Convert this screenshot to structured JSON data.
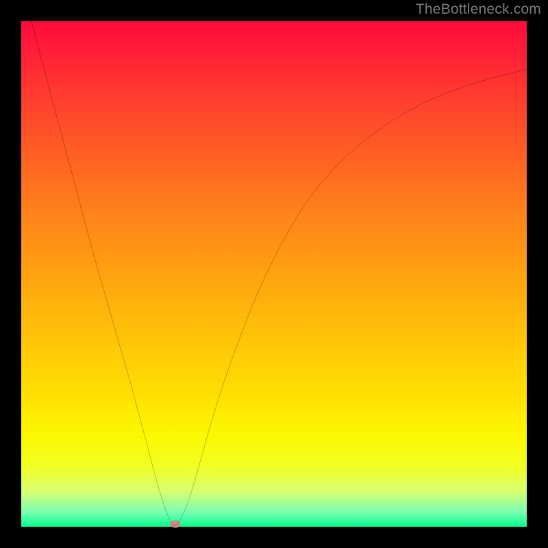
{
  "attribution": "TheBottleneck.com",
  "chart_data": {
    "type": "line",
    "title": "",
    "xlabel": "",
    "ylabel": "",
    "x_range": [
      0,
      100
    ],
    "y_range": [
      0,
      100
    ],
    "x": [
      2,
      6,
      10,
      14,
      18,
      22,
      26,
      28,
      29.5,
      30.5,
      32,
      34,
      38,
      42,
      48,
      55,
      62,
      70,
      78,
      86,
      94,
      100
    ],
    "values": [
      100,
      85,
      70,
      55,
      41,
      27,
      12,
      5,
      1.2,
      0.2,
      2.5,
      8,
      22,
      34,
      49,
      62,
      71,
      78,
      83,
      86.5,
      89,
      90.5
    ],
    "marker": {
      "x": 30.5,
      "y": 0.6
    },
    "colors": {
      "curve": "#000000",
      "marker": "#cf8b84",
      "gradient_top": "#ff0b3b",
      "gradient_bottom": "#05ff8b",
      "frame": "#000000"
    },
    "note": "V-shaped bottleneck curve. y encodes bottleneck severity (top=red=high, bottom=green=0). Minimum around x≈30.5. Values are estimated from the plot; no axis ticks are shown in the source."
  }
}
